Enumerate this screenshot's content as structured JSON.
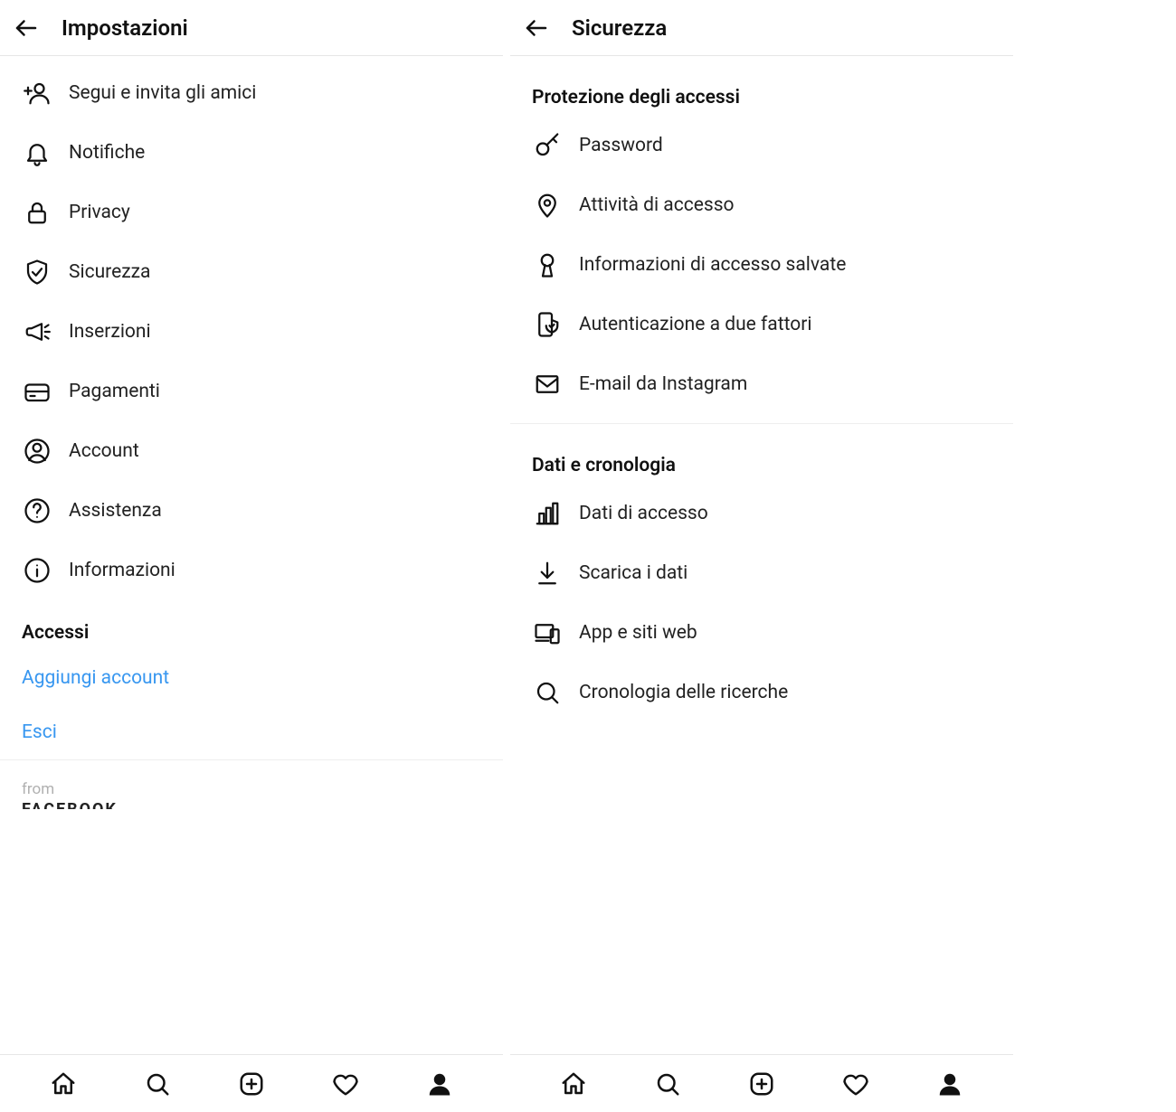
{
  "left": {
    "header_title": "Impostazioni",
    "items": [
      {
        "icon": "person-plus-icon",
        "label": "Segui e invita gli amici"
      },
      {
        "icon": "bell-icon",
        "label": "Notifiche"
      },
      {
        "icon": "lock-icon",
        "label": "Privacy"
      },
      {
        "icon": "shield-check-icon",
        "label": "Sicurezza"
      },
      {
        "icon": "megaphone-icon",
        "label": "Inserzioni"
      },
      {
        "icon": "card-icon",
        "label": "Pagamenti"
      },
      {
        "icon": "account-icon",
        "label": "Account"
      },
      {
        "icon": "help-icon",
        "label": "Assistenza"
      },
      {
        "icon": "info-icon",
        "label": "Informazioni"
      }
    ],
    "section_title": "Accessi",
    "link_add": "Aggiungi account",
    "link_logout": "Esci",
    "from_text": "from",
    "brand_text": "FACEBOOK"
  },
  "right": {
    "header_title": "Sicurezza",
    "section1_title": "Protezione degli accessi",
    "section1_items": [
      {
        "icon": "key-icon",
        "label": "Password"
      },
      {
        "icon": "location-icon",
        "label": "Attività di accesso"
      },
      {
        "icon": "keyhole-icon",
        "label": "Informazioni di accesso salvate"
      },
      {
        "icon": "phone-shield-icon",
        "label": "Autenticazione a due fattori"
      },
      {
        "icon": "mail-icon",
        "label": "E-mail da Instagram"
      }
    ],
    "section2_title": "Dati e cronologia",
    "section2_items": [
      {
        "icon": "chart-icon",
        "label": "Dati di accesso"
      },
      {
        "icon": "download-icon",
        "label": "Scarica i dati"
      },
      {
        "icon": "devices-icon",
        "label": "App e siti web"
      },
      {
        "icon": "search-icon",
        "label": "Cronologia delle ricerche"
      }
    ]
  },
  "tabbar": [
    {
      "icon": "home-icon"
    },
    {
      "icon": "search-icon"
    },
    {
      "icon": "add-icon"
    },
    {
      "icon": "heart-icon"
    },
    {
      "icon": "profile-icon"
    }
  ],
  "colors": {
    "link": "#3897f0"
  }
}
